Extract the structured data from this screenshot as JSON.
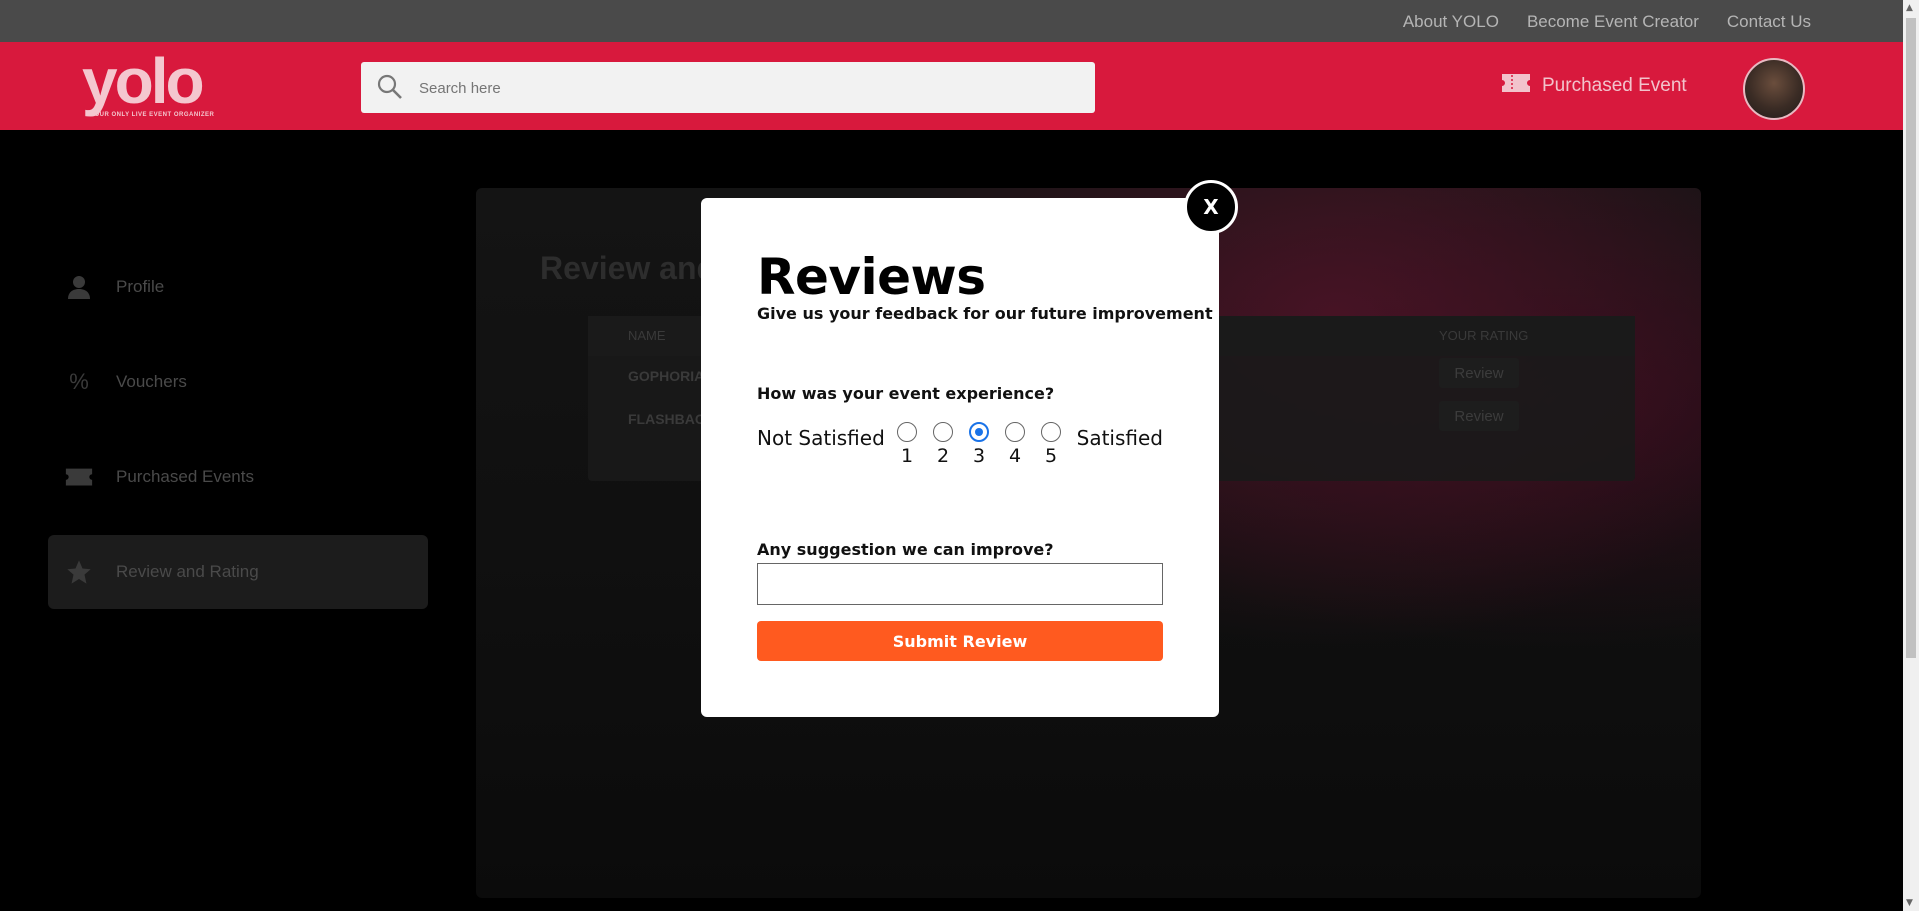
{
  "topbar": {
    "links": [
      "About YOLO",
      "Become Event Creator",
      "Contact Us"
    ]
  },
  "header": {
    "logo_text": "yolo",
    "logo_tagline": "YOUR ONLY LIVE EVENT ORGANIZER",
    "search_placeholder": "Search here",
    "purchased_label": "Purchased Event"
  },
  "sidebar": {
    "items": [
      {
        "label": "Profile",
        "icon": "person-icon"
      },
      {
        "label": "Vouchers",
        "icon": "percent-icon"
      },
      {
        "label": "Purchased Events",
        "icon": "ticket-icon"
      },
      {
        "label": "Review and Rating",
        "icon": "star-icon",
        "active": true
      }
    ]
  },
  "panel": {
    "title": "Review and Rating",
    "columns": {
      "name": "NAME",
      "rating": "YOUR RATING"
    },
    "rows": [
      {
        "name": "GOPHORIA",
        "action": "Review"
      },
      {
        "name": "FLASHBACK",
        "action": "Review"
      }
    ]
  },
  "modal": {
    "close_label": "X",
    "title": "Reviews",
    "subtitle": "Give us your feedback for our future improvement",
    "question1": "How was your event experience?",
    "scale_low": "Not Satisfied",
    "scale_high": "Satisfied",
    "options": [
      "1",
      "2",
      "3",
      "4",
      "5"
    ],
    "selected": 3,
    "question2": "Any suggestion we can improve?",
    "suggestion_value": "",
    "submit_label": "Submit Review"
  },
  "colors": {
    "header": "#d8193d",
    "submit": "#ff5a1f",
    "radio_selected": "#1a73e8"
  }
}
